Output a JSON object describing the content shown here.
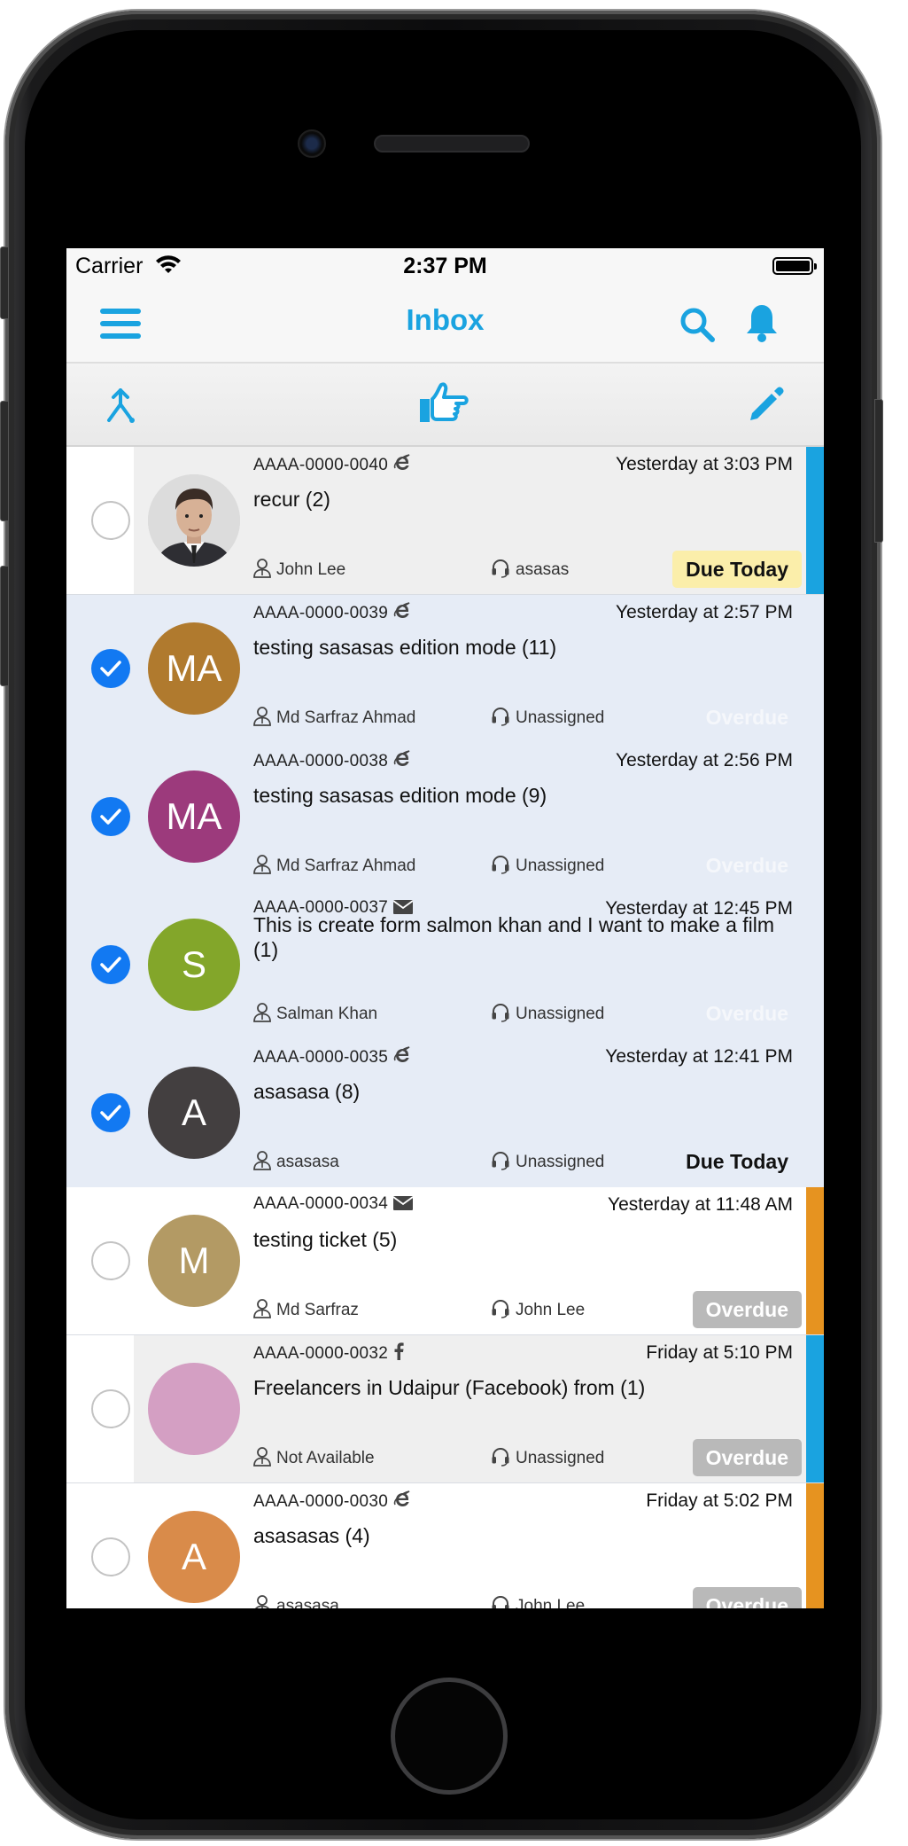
{
  "status_bar": {
    "carrier": "Carrier",
    "time": "2:37 PM"
  },
  "nav": {
    "title": "Inbox",
    "menu_icon": "hamburger-icon",
    "search_icon": "search-icon",
    "bell_icon": "bell-icon"
  },
  "toolbar": {
    "merge_icon": "merge-icon",
    "assign_icon": "hand-pointer-icon",
    "edit_icon": "pencil-icon"
  },
  "colors": {
    "accent": "#1aa3e0",
    "checkbox_on": "#1279f2",
    "stripe_blue": "#1aa3e0",
    "stripe_orange": "#e69320",
    "due_bg": "#fbeeaa",
    "overdue_bg": "#b9b9b9"
  },
  "tickets": [
    {
      "id": "AAAA-0000-0040",
      "channel": "ie-icon",
      "timestamp": "Yesterday at 3:03 PM",
      "subject": "recur (2)",
      "requester": "John  Lee",
      "agent": "asasas",
      "badge": "Due Today",
      "badge_style": "due",
      "checked": false,
      "avatar_text": "",
      "avatar_color": "#d5d5d5",
      "row_style": "grey",
      "stripe": "#1aa3e0"
    },
    {
      "id": "AAAA-0000-0039",
      "channel": "ie-icon",
      "timestamp": "Yesterday at 2:57 PM",
      "subject": "testing sasasas edition mode (11)",
      "requester": "Md Sarfraz Ahmad",
      "agent": "Unassigned",
      "badge": "Overdue",
      "badge_style": "ghost",
      "checked": true,
      "avatar_text": "MA",
      "avatar_color": "#b07a2e",
      "row_style": "selected",
      "stripe": ""
    },
    {
      "id": "AAAA-0000-0038",
      "channel": "ie-icon",
      "timestamp": "Yesterday at 2:56 PM",
      "subject": "testing sasasas edition mode (9)",
      "requester": "Md Sarfraz Ahmad",
      "agent": "Unassigned",
      "badge": "Overdue",
      "badge_style": "ghost",
      "checked": true,
      "avatar_text": "MA",
      "avatar_color": "#9c3a7c",
      "row_style": "selected",
      "stripe": ""
    },
    {
      "id": "AAAA-0000-0037",
      "channel": "mail-icon",
      "timestamp": "Yesterday at 12:45 PM",
      "subject": "This is create form salmon khan and I want to make a film (1)",
      "requester": "Salman Khan",
      "agent": "Unassigned",
      "badge": "Overdue",
      "badge_style": "ghost",
      "checked": true,
      "avatar_text": "S",
      "avatar_color": "#83a62a",
      "row_style": "selected",
      "stripe": ""
    },
    {
      "id": "AAAA-0000-0035",
      "channel": "ie-icon",
      "timestamp": "Yesterday at 12:41 PM",
      "subject": "asasasa (8)",
      "requester": "asasasa",
      "agent": "Unassigned",
      "badge": "Due Today",
      "badge_style": "plain",
      "checked": true,
      "avatar_text": "A",
      "avatar_color": "#433f40",
      "row_style": "selected",
      "stripe": ""
    },
    {
      "id": "AAAA-0000-0034",
      "channel": "mail-icon",
      "timestamp": "Yesterday at 11:48 AM",
      "subject": "testing ticket (5)",
      "requester": "Md Sarfraz",
      "agent": "John  Lee",
      "badge": "Overdue",
      "badge_style": "overdue",
      "checked": false,
      "avatar_text": "M",
      "avatar_color": "#b39a64",
      "row_style": "normal",
      "stripe": "#e69320"
    },
    {
      "id": "AAAA-0000-0032",
      "channel": "facebook-icon",
      "timestamp": "Friday at 5:10 PM",
      "subject": "Freelancers in Udaipur (Facebook) from  (1)",
      "requester": "Not Available",
      "agent": "Unassigned",
      "badge": "Overdue",
      "badge_style": "overdue",
      "checked": false,
      "avatar_text": "",
      "avatar_color": "#d49fc3",
      "row_style": "grey",
      "stripe": "#1aa3e0"
    },
    {
      "id": "AAAA-0000-0030",
      "channel": "ie-icon",
      "timestamp": "Friday at 5:02 PM",
      "subject": "asasasas (4)",
      "requester": "asasasa",
      "agent": "John  Lee",
      "badge": "Overdue",
      "badge_style": "overdue",
      "checked": false,
      "avatar_text": "A",
      "avatar_color": "#d98b4a",
      "row_style": "normal",
      "stripe": "#e69320"
    }
  ]
}
